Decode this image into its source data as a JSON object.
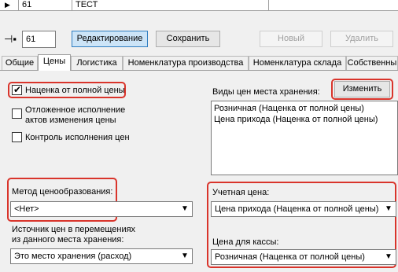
{
  "grid": {
    "row_indicator": "▶",
    "code": "61",
    "name": "ТЕСТ"
  },
  "toolbar": {
    "pin_icon": "pin-icon",
    "code_value": "61",
    "edit_label": "Редактирование",
    "save_label": "Сохранить",
    "new_label": "Новый",
    "delete_label": "Удалить"
  },
  "tabs": [
    {
      "label": "Общие"
    },
    {
      "label": "Цены"
    },
    {
      "label": "Логистика"
    },
    {
      "label": "Номенклатура производства"
    },
    {
      "label": "Номенклатура склада"
    },
    {
      "label": "Собственны"
    }
  ],
  "prices": {
    "markup_full_label": "Наценка от полной цены",
    "deferred_line1": "Отложенное исполнение",
    "deferred_line2": "актов изменения цены",
    "control_label": "Контроль исполнения цен",
    "price_types_label": "Виды цен места хранения:",
    "change_button": "Изменить",
    "price_types": [
      "Розничная (Наценка от полной цены)",
      "Цена прихода (Наценка от полной цены)"
    ],
    "pricing_method_label": "Метод ценообразования:",
    "pricing_method_value": "<Нет>",
    "source_line1": "Источник цен в перемещениях",
    "source_line2": "из данного места хранения:",
    "source_value": "Это место хранения (расход)",
    "accounting_price_label": "Учетная цена:",
    "accounting_price_value": "Цена прихода (Наценка от полной цены)",
    "cashier_price_label": "Цена для кассы:",
    "cashier_price_value": "Розничная (Наценка от полной цены)"
  },
  "colors": {
    "highlight": "#d9342b",
    "active_button": "#cce4f7"
  }
}
